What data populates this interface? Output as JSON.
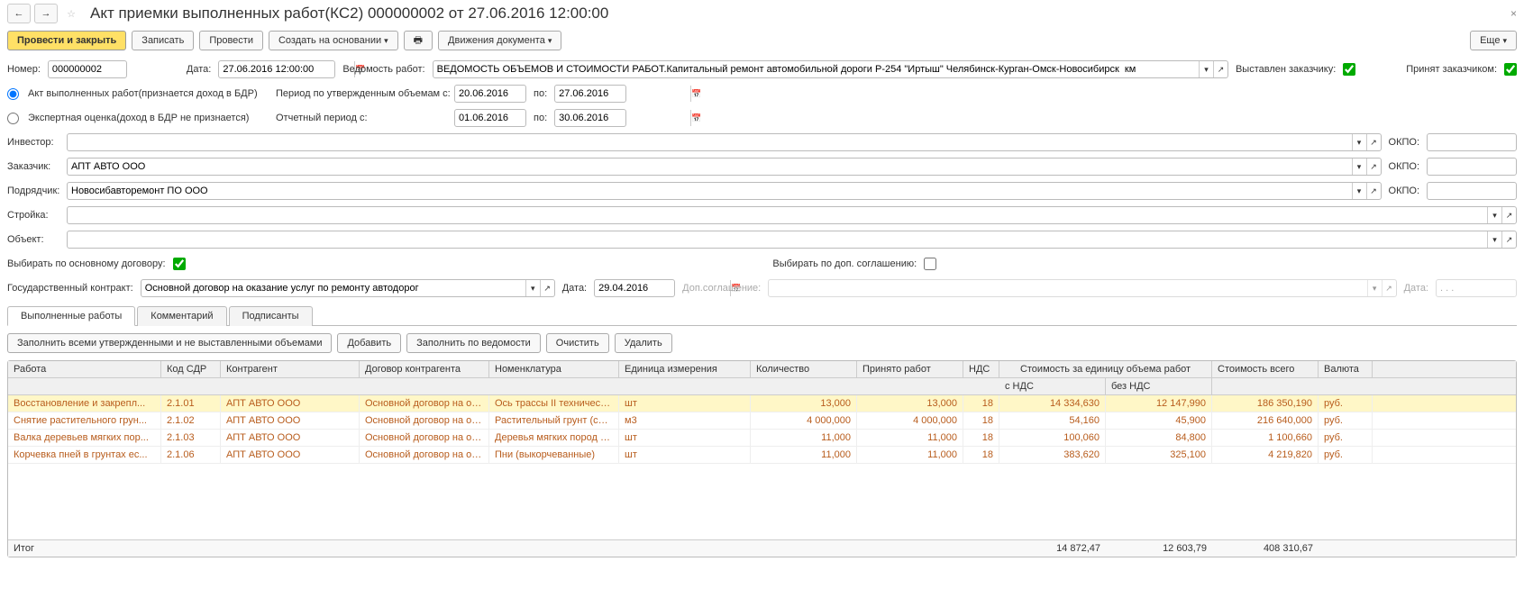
{
  "title": "Акт приемки выполненных работ(КС2) 000000002 от 27.06.2016 12:00:00",
  "toolbar": {
    "post_close": "Провести и закрыть",
    "save": "Записать",
    "post": "Провести",
    "create_from": "Создать на основании",
    "movements": "Движения документа",
    "more": "Еще"
  },
  "fields": {
    "number_label": "Номер:",
    "number": "000000002",
    "date_label": "Дата:",
    "date": "27.06.2016 12:00:00",
    "vedomost_label": "Ведомость работ:",
    "vedomost": "ВЕДОМОСТЬ ОБЪЕМОВ И СТОИМОСТИ РАБОТ.Капитальный ремонт автомобильной дороги Р-254 \"Иртыш\" Челябинск-Курган-Омск-Новосибирск  км",
    "issued_label": "Выставлен заказчику:",
    "accepted_label": "Принят заказчиком:",
    "radio_act": "Акт выполненных работ(признается доход в БДР)",
    "radio_expert": "Экспертная оценка(доход в БДР не признается)",
    "period_approved": "Период по утвержденным объемам с:",
    "period_approved_from": "20.06.2016",
    "period_approved_to": "27.06.2016",
    "po": "по:",
    "report_period": "Отчетный период с:",
    "report_from": "01.06.2016",
    "report_to": "30.06.2016",
    "investor_label": "Инвестор:",
    "investor": "",
    "customer_label": "Заказчик:",
    "customer": "АПТ АВТО ООО",
    "contractor_label": "Подрядчик:",
    "contractor": "Новосибавторемонт ПО ООО",
    "construction_label": "Стройка:",
    "construction": "",
    "object_label": "Объект:",
    "object": "",
    "okpo": "ОКПО:",
    "select_main_contract": "Выбирать по основному договору:",
    "select_dop": "Выбирать по доп. соглашению:",
    "gov_contract_label": "Государственный контракт:",
    "gov_contract": "Основной договор на оказание услуг по ремонту автодорог",
    "gov_date_label": "Дата:",
    "gov_date": "29.04.2016",
    "dop_label": "Доп.соглашение:",
    "dop_date_label": "Дата:",
    "dop_date": ". . ."
  },
  "tabs": {
    "works": "Выполненные работы",
    "comment": "Комментарий",
    "signers": "Подписанты"
  },
  "tab_toolbar": {
    "fill_approved": "Заполнить всеми утвержденными и не выставленными объемами",
    "add": "Добавить",
    "fill_ved": "Заполнить по ведомости",
    "clear": "Очистить",
    "delete": "Удалить"
  },
  "grid": {
    "headers": {
      "rabota": "Работа",
      "sdr": "Код СДР",
      "contragent": "Контрагент",
      "dogovor": "Договор контрагента",
      "nomen": "Номенклатура",
      "unit": "Единица измерения",
      "qty": "Количество",
      "accepted": "Принято работ",
      "nds": "НДС",
      "unit_cost": "Стоимость за единицу объема работ",
      "with_nds": "с НДС",
      "no_nds": "без НДС",
      "total": "Стоимость всего",
      "currency": "Валюта"
    },
    "rows": [
      {
        "rabota": "Восстановление и закрепл...",
        "sdr": "2.1.01",
        "contragent": "АПТ АВТО ООО",
        "dogovor": "Основной договор на оказ...",
        "nomen": "Ось трассы II технической...",
        "unit": "шт",
        "qty": "13,000",
        "accepted": "13,000",
        "nds": "18",
        "with_nds": "14 334,630",
        "no_nds": "12 147,990",
        "total": "186 350,190",
        "currency": "руб."
      },
      {
        "rabota": "Снятие  растительного грун...",
        "sdr": "2.1.02",
        "contragent": "АПТ АВТО ООО",
        "dogovor": "Основной договор на оказ...",
        "nomen": "Растительный грунт (снят...",
        "unit": "м3",
        "qty": "4 000,000",
        "accepted": "4 000,000",
        "nds": "18",
        "with_nds": "54,160",
        "no_nds": "45,900",
        "total": "216 640,000",
        "currency": "руб."
      },
      {
        "rabota": "Валка деревьев мягких пор...",
        "sdr": "2.1.03",
        "contragent": "АПТ АВТО ООО",
        "dogovor": "Основной договор на оказ...",
        "nomen": "Деревья мягких пород тон...",
        "unit": "шт",
        "qty": "11,000",
        "accepted": "11,000",
        "nds": "18",
        "with_nds": "100,060",
        "no_nds": "84,800",
        "total": "1 100,660",
        "currency": "руб."
      },
      {
        "rabota": "Корчевка пней в грунтах ес...",
        "sdr": "2.1.06",
        "contragent": "АПТ АВТО ООО",
        "dogovor": "Основной договор на оказ...",
        "nomen": "Пни (выкорчеванные)",
        "unit": "шт",
        "qty": "11,000",
        "accepted": "11,000",
        "nds": "18",
        "with_nds": "383,620",
        "no_nds": "325,100",
        "total": "4 219,820",
        "currency": "руб."
      }
    ],
    "footer": {
      "label": "Итог",
      "with_nds": "14 872,47",
      "no_nds": "12 603,79",
      "total": "408 310,67"
    }
  }
}
